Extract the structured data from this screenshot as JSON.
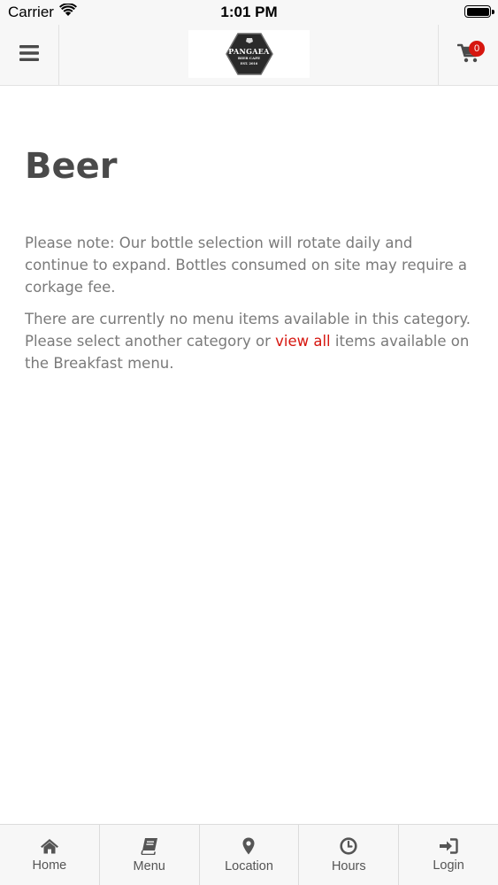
{
  "status_bar": {
    "carrier": "Carrier",
    "time": "1:01 PM"
  },
  "header": {
    "logo": {
      "name": "PANGAEA",
      "subtitle": "BIER CAFE",
      "est": "EST. 2016"
    },
    "cart_count": "0"
  },
  "content": {
    "title": "Beer",
    "note": "Please note: Our bottle selection will rotate daily and continue to expand. Bottles consumed on site may require a corkage fee.",
    "empty_prefix": "There are currently no menu items available in this category. Please select another category or ",
    "empty_link": "view all",
    "empty_suffix": " items available on the Breakfast menu."
  },
  "tabs": [
    {
      "label": "Home",
      "icon": "home-icon"
    },
    {
      "label": "Menu",
      "icon": "book-icon"
    },
    {
      "label": "Location",
      "icon": "map-marker-icon"
    },
    {
      "label": "Hours",
      "icon": "clock-icon"
    },
    {
      "label": "Login",
      "icon": "sign-in-icon"
    }
  ],
  "colors": {
    "accent": "#d6160f",
    "title": "#4a4a4a",
    "body_text": "#7a7a7a",
    "bar_background": "#f7f7f7"
  }
}
